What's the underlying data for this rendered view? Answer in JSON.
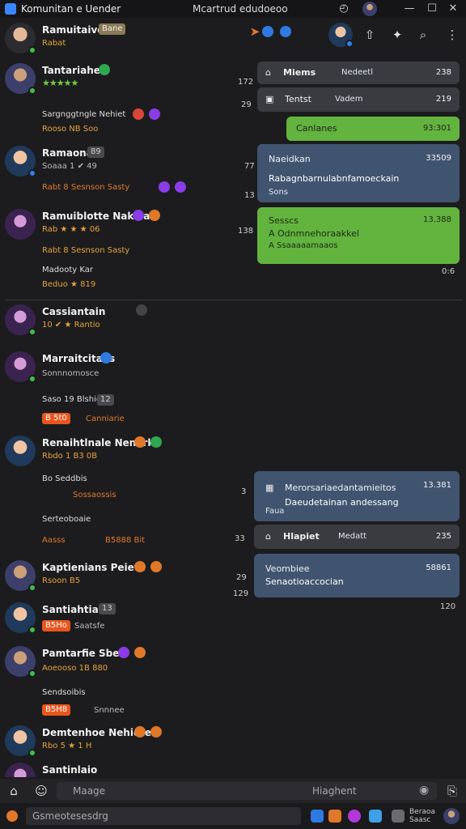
{
  "window": {
    "title": "Komunitan e Uender",
    "center_title": "Mcartrud edudoeoo",
    "minimize": "—",
    "maximize": "☐",
    "close": "✕"
  },
  "header": {
    "name": "Ramuitaive",
    "tag": "Bane",
    "sub": "Rabat",
    "icons": [
      "compass-icon",
      "globe-icon"
    ]
  },
  "toolbar": {
    "icons": [
      "share-icon",
      "pin-icon",
      "search-icon",
      "more-icon"
    ],
    "more_label": "⋮"
  },
  "contacts": [
    {
      "name": "Tantariahe",
      "badge": "•",
      "rating": "★★★★★",
      "meta": "172"
    },
    {
      "name": "Ramaona",
      "tag": "89",
      "sub": "Soaaa 1 ✔ 49",
      "meta": "77",
      "meta2": "13"
    },
    {
      "name": "Ramuiblotte Nakeia",
      "sub": "Rab ★ ★ ★ 06",
      "meta": "138"
    },
    {
      "name": "Cassiantain",
      "sub": "10 ✔ ★ Rantio"
    },
    {
      "name": "Marraitcitaes",
      "sub": "Sonnnomosce"
    },
    {
      "name": "Renaihtlnale Nenerk",
      "sub": "Rbdo 1 B3 0B"
    },
    {
      "name": "Kaptienians Peieta",
      "sub": "Rsoon B5"
    },
    {
      "name": "Santiahtiaie",
      "sub": "Saatsfe"
    },
    {
      "name": "Pamtarfie Sbes",
      "sub": "Aoeooso 1B 880"
    },
    {
      "name": "Demtenhoe Nehiete",
      "sub": "Rbo 5 ★ 1 H"
    },
    {
      "name": "Santinlaio",
      "tag": "13"
    }
  ],
  "subrows": [
    {
      "label": "Sargnggtngle Nehiet",
      "extra": "Rooso NB Soo"
    },
    {
      "label": "Rabt 8 Sesnson Sasty",
      "extra": ""
    },
    {
      "label": "Madooty Kar",
      "extra": "Beduo ★ 819"
    },
    {
      "label": "Saso 19 Blshio",
      "tag": "12"
    },
    {
      "label": "B 5t0",
      "extra": "Canniarie"
    },
    {
      "label": "Bo Seddbis",
      "extra": "Sossaossis"
    },
    {
      "label": "Serteoboaie",
      "extra": ""
    },
    {
      "label": "Aasss",
      "extra": "B5888 Bit"
    },
    {
      "label": "Sesnso",
      "extra": "B5Ho"
    },
    {
      "label": "Sendsoibis",
      "extra": ""
    },
    {
      "label": "B5H8",
      "extra": "Snnnee"
    }
  ],
  "cards": [
    {
      "title": "Miems",
      "subtitle": "Nedeetl",
      "count": "238",
      "type": "dark"
    },
    {
      "title": "Tentst",
      "subtitle": "Vadem",
      "count": "219",
      "type": "dark"
    },
    {
      "title": "Canlanes",
      "time": "93:301",
      "type": "green"
    },
    {
      "title": "Naeidkan",
      "body": "Rabagnbarnulabnfamoeckain",
      "meta": "Sons",
      "time": "33509",
      "type": "blue"
    },
    {
      "title": "Sesscs",
      "body": "A Odnmnehoraakkel",
      "meta": "A Ssaaaaamaaos",
      "time": "13.388",
      "type": "green"
    },
    {
      "title": "Merorsariaedantamieitos",
      "body": "Daeudetainan andessang",
      "meta": "Faua",
      "time": "13.381",
      "type": "blue"
    },
    {
      "title": "Hlapiet",
      "subtitle": "Medatt",
      "count": "235",
      "type": "dark"
    },
    {
      "title": "Veombiee",
      "body": "Senaotioaccocian",
      "time": "58861",
      "type": "blue"
    }
  ],
  "times": [
    "172",
    "138",
    "77",
    "13",
    "138",
    "0:6",
    "3",
    "33",
    "29",
    "129",
    "120"
  ],
  "composer": {
    "placeholder": "Maage",
    "right_label": "Hiaghent",
    "search_placeholder": "Gsmeotesesdrg",
    "user_label": "Beraoa Saasc"
  },
  "colors": {
    "background": "#1c1c1e",
    "card_dark": "#3a3b40",
    "card_blue": "#41546f",
    "card_green": "#63b33f",
    "online": "#3fbf4a",
    "badge_orange": "#e8561f"
  }
}
